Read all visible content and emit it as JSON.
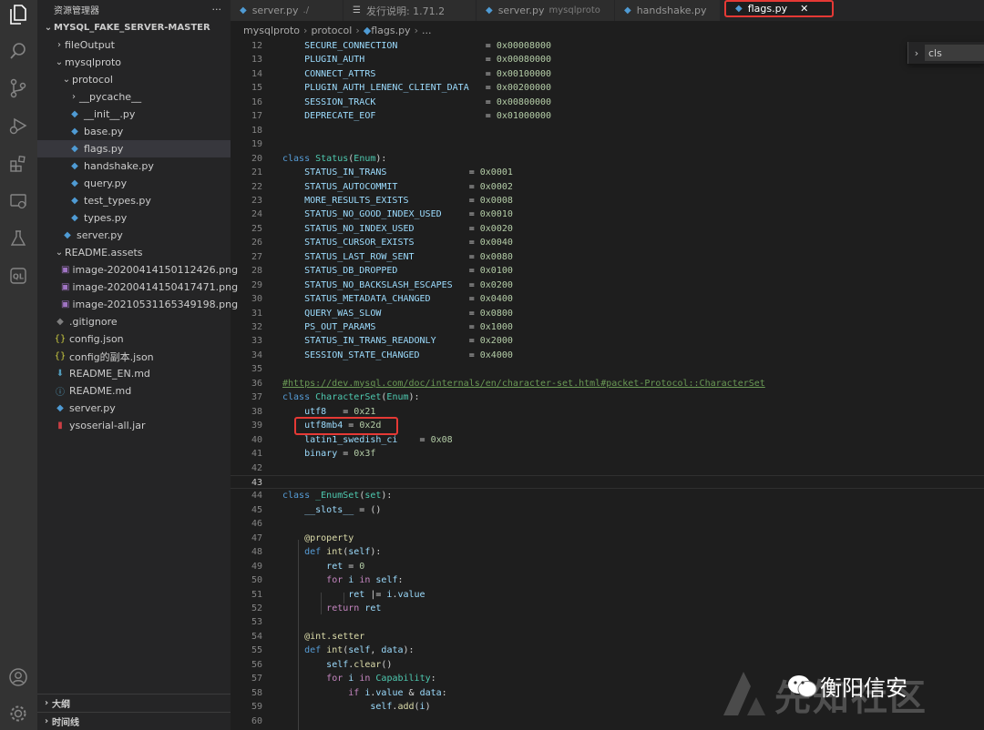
{
  "explorer": {
    "title": "资源管理器",
    "more": "···",
    "root": "MYSQL_FAKE_SERVER-MASTER",
    "tree": [
      {
        "label": "fileOutput",
        "indent": 0,
        "kind": "folder",
        "open": false
      },
      {
        "label": "mysqlproto",
        "indent": 0,
        "kind": "folder",
        "open": true
      },
      {
        "label": "protocol",
        "indent": 1,
        "kind": "folder",
        "open": true
      },
      {
        "label": "__pycache__",
        "indent": 2,
        "kind": "folder",
        "open": false
      },
      {
        "label": "__init__.py",
        "indent": 2,
        "kind": "py"
      },
      {
        "label": "base.py",
        "indent": 2,
        "kind": "py"
      },
      {
        "label": "flags.py",
        "indent": 2,
        "kind": "py",
        "selected": true
      },
      {
        "label": "handshake.py",
        "indent": 2,
        "kind": "py"
      },
      {
        "label": "query.py",
        "indent": 2,
        "kind": "py"
      },
      {
        "label": "test_types.py",
        "indent": 2,
        "kind": "py"
      },
      {
        "label": "types.py",
        "indent": 2,
        "kind": "py"
      },
      {
        "label": "server.py",
        "indent": 1,
        "kind": "py"
      },
      {
        "label": "README.assets",
        "indent": 0,
        "kind": "folder",
        "open": true
      },
      {
        "label": "image-20200414150112426.png",
        "indent": 1,
        "kind": "img"
      },
      {
        "label": "image-20200414150417471.png",
        "indent": 1,
        "kind": "img"
      },
      {
        "label": "image-20210531165349198.png",
        "indent": 1,
        "kind": "img"
      },
      {
        "label": ".gitignore",
        "indent": 0,
        "kind": "git"
      },
      {
        "label": "config.json",
        "indent": 0,
        "kind": "json"
      },
      {
        "label": "config的副本.json",
        "indent": 0,
        "kind": "json"
      },
      {
        "label": "README_EN.md",
        "indent": 0,
        "kind": "md"
      },
      {
        "label": "README.md",
        "indent": 0,
        "kind": "info"
      },
      {
        "label": "server.py",
        "indent": 0,
        "kind": "py"
      },
      {
        "label": "ysoserial-all.jar",
        "indent": 0,
        "kind": "jar"
      }
    ],
    "outline": "大纲",
    "timeline": "时间线"
  },
  "tabs": [
    {
      "label": "server.py",
      "desc": "./",
      "icon": "python-icon"
    },
    {
      "label": "发行说明: 1.71.2",
      "desc": "",
      "icon": "notes-icon"
    },
    {
      "label": "server.py",
      "desc": "mysqlproto",
      "icon": "python-icon"
    },
    {
      "label": "handshake.py",
      "desc": "",
      "icon": "python-icon"
    },
    {
      "label": "flags.py",
      "desc": "",
      "icon": "python-icon",
      "active": true,
      "close": "✕"
    }
  ],
  "breadcrumbs": [
    "mysqlproto",
    "protocol",
    "flags.py",
    "..."
  ],
  "find_widget": {
    "chevron": "›",
    "value": "cls"
  },
  "current_line": 43,
  "highlighted_line": 39,
  "code_lines": [
    {
      "n": 12,
      "html": "    <span class='v'>SECURE_CONNECTION</span>                = <span class='n'>0x00008000</span>"
    },
    {
      "n": 13,
      "html": "    <span class='v'>PLUGIN_AUTH</span>                      = <span class='n'>0x00080000</span>"
    },
    {
      "n": 14,
      "html": "    <span class='v'>CONNECT_ATTRS</span>                    = <span class='n'>0x00100000</span>"
    },
    {
      "n": 15,
      "html": "    <span class='v'>PLUGIN_AUTH_LENENC_CLIENT_DATA</span>   = <span class='n'>0x00200000</span>"
    },
    {
      "n": 16,
      "html": "    <span class='v'>SESSION_TRACK</span>                    = <span class='n'>0x00800000</span>"
    },
    {
      "n": 17,
      "html": "    <span class='v'>DEPRECATE_EOF</span>                    = <span class='n'>0x01000000</span>"
    },
    {
      "n": 18,
      "html": ""
    },
    {
      "n": 19,
      "html": ""
    },
    {
      "n": 20,
      "html": "<span class='k'>class</span> <span class='c'>Status</span>(<span class='c'>Enum</span>):"
    },
    {
      "n": 21,
      "html": "    <span class='v'>STATUS_IN_TRANS</span>               = <span class='n'>0x0001</span>"
    },
    {
      "n": 22,
      "html": "    <span class='v'>STATUS_AUTOCOMMIT</span>             = <span class='n'>0x0002</span>"
    },
    {
      "n": 23,
      "html": "    <span class='v'>MORE_RESULTS_EXISTS</span>           = <span class='n'>0x0008</span>"
    },
    {
      "n": 24,
      "html": "    <span class='v'>STATUS_NO_GOOD_INDEX_USED</span>     = <span class='n'>0x0010</span>"
    },
    {
      "n": 25,
      "html": "    <span class='v'>STATUS_NO_INDEX_USED</span>          = <span class='n'>0x0020</span>"
    },
    {
      "n": 26,
      "html": "    <span class='v'>STATUS_CURSOR_EXISTS</span>          = <span class='n'>0x0040</span>"
    },
    {
      "n": 27,
      "html": "    <span class='v'>STATUS_LAST_ROW_SENT</span>          = <span class='n'>0x0080</span>"
    },
    {
      "n": 28,
      "html": "    <span class='v'>STATUS_DB_DROPPED</span>             = <span class='n'>0x0100</span>"
    },
    {
      "n": 29,
      "html": "    <span class='v'>STATUS_NO_BACKSLASH_ESCAPES</span>   = <span class='n'>0x0200</span>"
    },
    {
      "n": 30,
      "html": "    <span class='v'>STATUS_METADATA_CHANGED</span>       = <span class='n'>0x0400</span>"
    },
    {
      "n": 31,
      "html": "    <span class='v'>QUERY_WAS_SLOW</span>                = <span class='n'>0x0800</span>"
    },
    {
      "n": 32,
      "html": "    <span class='v'>PS_OUT_PARAMS</span>                 = <span class='n'>0x1000</span>"
    },
    {
      "n": 33,
      "html": "    <span class='v'>STATUS_IN_TRANS_READONLY</span>      = <span class='n'>0x2000</span>"
    },
    {
      "n": 34,
      "html": "    <span class='v'>SESSION_STATE_CHANGED</span>         = <span class='n'>0x4000</span>"
    },
    {
      "n": 35,
      "html": ""
    },
    {
      "n": 36,
      "html": "<span class='cm'>#https://dev.mysql.com/doc/internals/en/character-set.html#packet-Protocol::CharacterSet</span>"
    },
    {
      "n": 37,
      "html": "<span class='k'>class</span> <span class='c'>CharacterSet</span>(<span class='c'>Enum</span>):"
    },
    {
      "n": 38,
      "html": "    <span class='v'>utf8</span>   = <span class='n'>0x21</span>"
    },
    {
      "n": 39,
      "html": "    <span class='v'>utf8mb4</span> = <span class='n'>0x2d</span>"
    },
    {
      "n": 40,
      "html": "    <span class='v'>latin1_swedish_ci</span>    = <span class='n'>0x08</span>"
    },
    {
      "n": 41,
      "html": "    <span class='v'>binary</span> = <span class='n'>0x3f</span>"
    },
    {
      "n": 42,
      "html": ""
    },
    {
      "n": 43,
      "html": ""
    },
    {
      "n": 44,
      "html": "<span class='k'>class</span> <span class='c'>_EnumSet</span>(<span class='c'>set</span>):"
    },
    {
      "n": 45,
      "html": "    <span class='v'>__slots__</span> = ()"
    },
    {
      "n": 46,
      "html": ""
    },
    {
      "n": 47,
      "html": "    <span class='fn'>@property</span>"
    },
    {
      "n": 48,
      "html": "    <span class='k'>def</span> <span class='fn'>int</span>(<span class='v'>self</span>):"
    },
    {
      "n": 49,
      "html": "        <span class='v'>ret</span> = <span class='n'>0</span>"
    },
    {
      "n": 50,
      "html": "        <span class='kw2'>for</span> <span class='v'>i</span> <span class='kw2'>in</span> <span class='v'>self</span>:"
    },
    {
      "n": 51,
      "html": "            <span class='v'>ret</span> |= <span class='v'>i</span>.<span class='v'>value</span>"
    },
    {
      "n": 52,
      "html": "        <span class='kw2'>return</span> <span class='v'>ret</span>"
    },
    {
      "n": 53,
      "html": ""
    },
    {
      "n": 54,
      "html": "    <span class='fn'>@int.setter</span>"
    },
    {
      "n": 55,
      "html": "    <span class='k'>def</span> <span class='fn'>int</span>(<span class='v'>self</span>, <span class='v'>data</span>):"
    },
    {
      "n": 56,
      "html": "        <span class='v'>self</span>.<span class='fn'>clear</span>()"
    },
    {
      "n": 57,
      "html": "        <span class='kw2'>for</span> <span class='v'>i</span> <span class='kw2'>in</span> <span class='c'>Capability</span>:"
    },
    {
      "n": 58,
      "html": "            <span class='kw2'>if</span> <span class='v'>i</span>.<span class='v'>value</span> &amp; <span class='v'>data</span>:"
    },
    {
      "n": 59,
      "html": "                <span class='v'>self</span>.<span class='fn'>add</span>(<span class='v'>i</span>)"
    },
    {
      "n": 60,
      "html": ""
    }
  ],
  "watermark": {
    "text": "先知社区",
    "account": "衡阳信安"
  }
}
